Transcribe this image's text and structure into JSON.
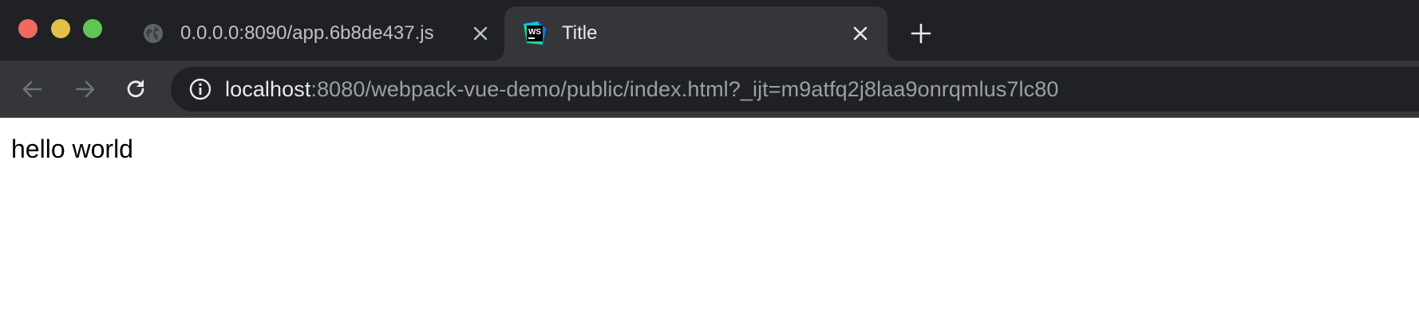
{
  "browser": {
    "window_controls": [
      "close",
      "minimize",
      "zoom"
    ],
    "tabs": [
      {
        "title": "0.0.0.0:8090/app.6b8de437.js",
        "favicon": "globe-icon",
        "active": false
      },
      {
        "title": "Title",
        "favicon": "webstorm-icon",
        "favicon_text": "WS",
        "active": true
      }
    ],
    "toolbar": {
      "back_icon": "back-arrow-icon",
      "forward_icon": "forward-arrow-icon",
      "reload_icon": "reload-icon",
      "address": {
        "security_icon": "info-icon",
        "host": "localhost",
        "rest": ":8080/webpack-vue-demo/public/index.html?_ijt=m9atfq2j8laa9onrqmlus7lc80"
      }
    }
  },
  "page": {
    "text": "hello world"
  },
  "colors": {
    "tabstrip_bg": "#202124",
    "toolbar_bg": "#35363a",
    "omnibox_bg": "#202124",
    "traffic_red": "#ed6a5e",
    "traffic_yellow": "#e3c148",
    "traffic_green": "#61c554"
  }
}
